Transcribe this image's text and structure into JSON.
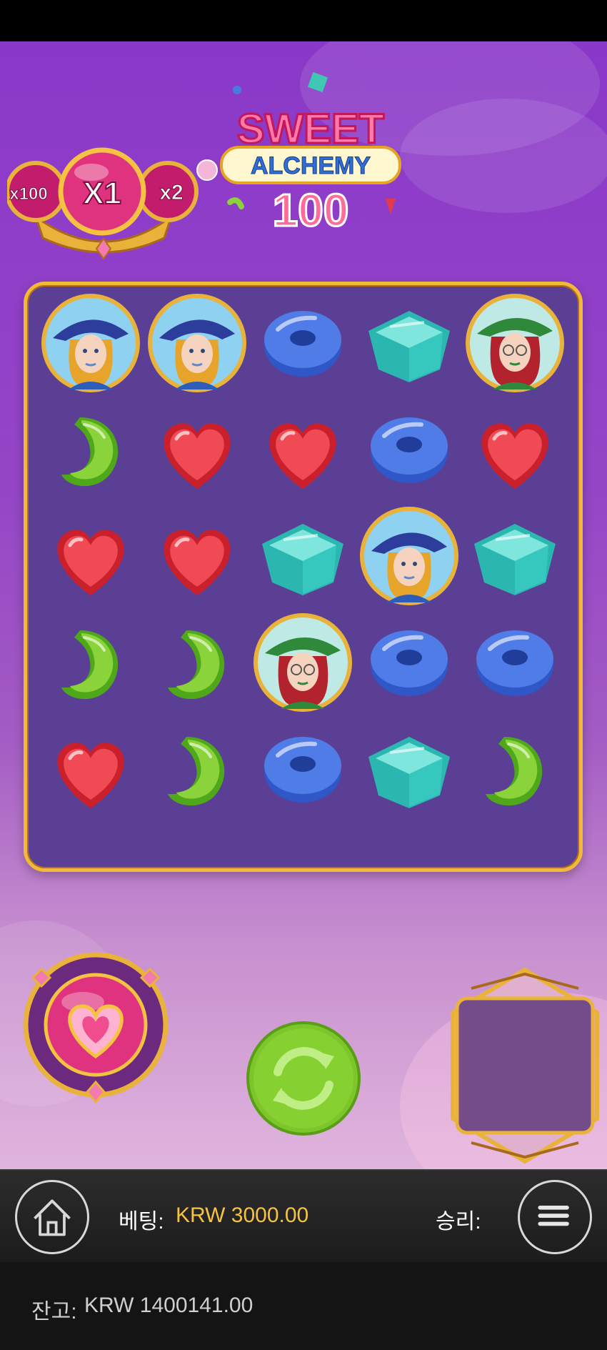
{
  "game": {
    "logo_word1": "SWEET",
    "logo_word2": "ALCHEMY",
    "logo_word3": "100",
    "multipliers": {
      "left": "x100",
      "center": "X1",
      "right": "x2"
    }
  },
  "grid": {
    "rows": [
      [
        "witch-blue",
        "witch-blue",
        "donut-blue",
        "cube-teal",
        "witch-green"
      ],
      [
        "bean-green",
        "heart-red",
        "heart-red",
        "donut-blue",
        "heart-red"
      ],
      [
        "heart-red",
        "heart-red",
        "cube-teal",
        "witch-blue",
        "cube-teal"
      ],
      [
        "bean-green",
        "bean-green",
        "witch-green",
        "donut-blue",
        "donut-blue"
      ],
      [
        "heart-red",
        "bean-green",
        "donut-blue",
        "cube-teal",
        "bean-green"
      ]
    ]
  },
  "controls": {
    "home_icon": "home-icon",
    "menu_icon": "menu-icon",
    "spin_icon": "refresh-icon",
    "power_icon": "heart-icon"
  },
  "bar": {
    "bet_label": "베팅:",
    "bet_value": "KRW 3000.00",
    "win_label": "승리:",
    "balance_label": "잔고:",
    "balance_value": "KRW 1400141.00"
  },
  "colors": {
    "accent_gold": "#f5c242",
    "frame_gold": "#f0b93a",
    "grid_bg": "#5a3f95",
    "spin_green": "#7cc52a"
  }
}
